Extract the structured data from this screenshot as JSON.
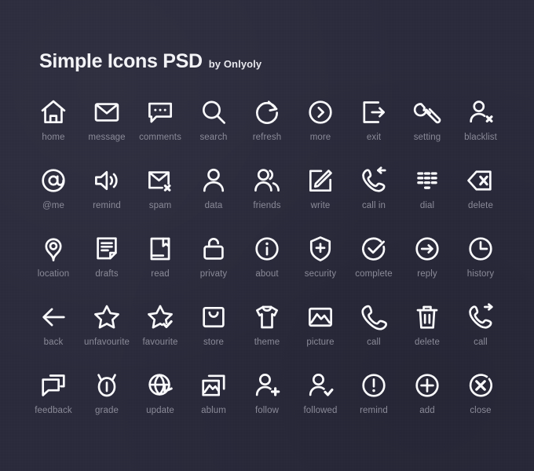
{
  "header": {
    "title": "Simple Icons PSD",
    "byline": "by Onlyoly"
  },
  "colors": {
    "background": "#2b2b3c",
    "icon": "#fbfbfd",
    "label": "#8b8b99",
    "title": "#f4f4f7"
  },
  "grid": {
    "columns": 9,
    "rows": 5,
    "count": 45
  },
  "icons": [
    {
      "label": "home",
      "icon": "home-icon"
    },
    {
      "label": "message",
      "icon": "envelope-icon"
    },
    {
      "label": "comments",
      "icon": "speech-bubble-dots-icon"
    },
    {
      "label": "search",
      "icon": "magnifier-icon"
    },
    {
      "label": "refresh",
      "icon": "refresh-arrow-icon"
    },
    {
      "label": "more",
      "icon": "circle-chevron-right-icon"
    },
    {
      "label": "exit",
      "icon": "exit-arrow-icon"
    },
    {
      "label": "setting",
      "icon": "wrench-icon"
    },
    {
      "label": "blacklist",
      "icon": "person-x-icon"
    },
    {
      "label": "@me",
      "icon": "at-sign-icon"
    },
    {
      "label": "remind",
      "icon": "speaker-icon"
    },
    {
      "label": "spam",
      "icon": "envelope-x-icon"
    },
    {
      "label": "data",
      "icon": "person-icon"
    },
    {
      "label": "friends",
      "icon": "two-people-icon"
    },
    {
      "label": "write",
      "icon": "pencil-square-icon"
    },
    {
      "label": "call in",
      "icon": "phone-incoming-icon"
    },
    {
      "label": "dial",
      "icon": "keypad-icon"
    },
    {
      "label": "delete",
      "icon": "backspace-x-icon"
    },
    {
      "label": "location",
      "icon": "map-pin-icon"
    },
    {
      "label": "drafts",
      "icon": "document-lines-icon"
    },
    {
      "label": "read",
      "icon": "book-bookmark-icon"
    },
    {
      "label": "privaty",
      "icon": "open-padlock-icon"
    },
    {
      "label": "about",
      "icon": "circle-info-icon"
    },
    {
      "label": "security",
      "icon": "shield-plus-icon"
    },
    {
      "label": "complete",
      "icon": "circle-check-icon"
    },
    {
      "label": "reply",
      "icon": "circle-arrow-right-icon"
    },
    {
      "label": "history",
      "icon": "clock-icon"
    },
    {
      "label": "back",
      "icon": "arrow-left-icon"
    },
    {
      "label": "unfavourite",
      "icon": "star-outline-icon"
    },
    {
      "label": "favourite",
      "icon": "star-check-icon"
    },
    {
      "label": "store",
      "icon": "shopping-bag-icon"
    },
    {
      "label": "theme",
      "icon": "tshirt-icon"
    },
    {
      "label": "picture",
      "icon": "photo-icon"
    },
    {
      "label": "call",
      "icon": "phone-handset-icon"
    },
    {
      "label": "delete",
      "icon": "trash-can-icon"
    },
    {
      "label": "call",
      "icon": "phone-outgoing-icon"
    },
    {
      "label": "feedback",
      "icon": "chat-bubbles-icon"
    },
    {
      "label": "grade",
      "icon": "medal-icon"
    },
    {
      "label": "update",
      "icon": "globe-refresh-icon"
    },
    {
      "label": "ablum",
      "icon": "photo-stack-icon"
    },
    {
      "label": "follow",
      "icon": "person-plus-icon"
    },
    {
      "label": "followed",
      "icon": "person-check-icon"
    },
    {
      "label": "remind",
      "icon": "circle-exclamation-icon"
    },
    {
      "label": "add",
      "icon": "circle-plus-icon"
    },
    {
      "label": "close",
      "icon": "circle-x-icon"
    }
  ]
}
